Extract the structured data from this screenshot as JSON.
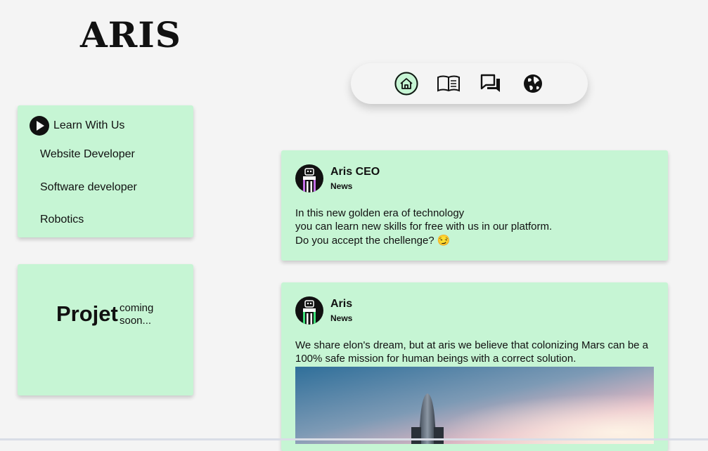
{
  "brand": {
    "logo_text": "ARIS"
  },
  "nav": {
    "items": [
      {
        "icon": "home-icon",
        "active": true
      },
      {
        "icon": "book-icon",
        "active": false
      },
      {
        "icon": "chat-icon",
        "active": false
      },
      {
        "icon": "globe-icon",
        "active": false
      }
    ]
  },
  "sidebar": {
    "learn": {
      "heading": "Learn With Us",
      "items": [
        "Website Developer",
        "Software developer",
        "Robotics"
      ]
    },
    "project": {
      "title": "Projet",
      "subtitle": "coming soon..."
    }
  },
  "posts": [
    {
      "author": "Aris CEO",
      "tag": "News",
      "lines": [
        "In this new golden era of technology",
        "you can learn new skills for free with us in our platform.",
        "Do you accept the chellenge? 😏"
      ]
    },
    {
      "author": "Aris",
      "tag": "News",
      "text": "We share elon's dream, but at aris we believe that colonizing Mars can be a 100% safe mission for human beings with a correct solution."
    }
  ],
  "colors": {
    "card": "#c6f5d4",
    "background": "#f4f4f4",
    "text": "#111111"
  }
}
